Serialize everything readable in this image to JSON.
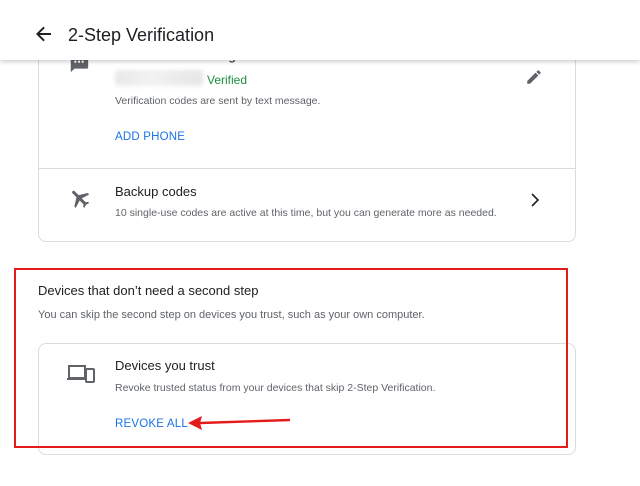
{
  "header": {
    "title": "2-Step Verification",
    "back_icon": "arrow-back-icon"
  },
  "voice_text": {
    "title": "Voice or text message",
    "status": "Verified",
    "description": "Verification codes are sent by text message.",
    "add_phone_label": "ADD PHONE",
    "icon": "message-icon"
  },
  "backup_codes": {
    "title": "Backup codes",
    "description": "10 single-use codes are active at this time, but you can generate more as needed.",
    "icon": "plane-icon"
  },
  "devices_section": {
    "heading": "Devices that don’t need a second step",
    "description": "You can skip the second step on devices you trust, such as your own computer."
  },
  "trusted_devices": {
    "title": "Devices you trust",
    "description": "Revoke trusted status from your devices that skip 2-Step Verification.",
    "revoke_label": "REVOKE ALL",
    "icon": "devices-icon"
  },
  "colors": {
    "accent": "#1a73e8",
    "verified": "#1e8e3e",
    "highlight": "#e31b1b"
  }
}
